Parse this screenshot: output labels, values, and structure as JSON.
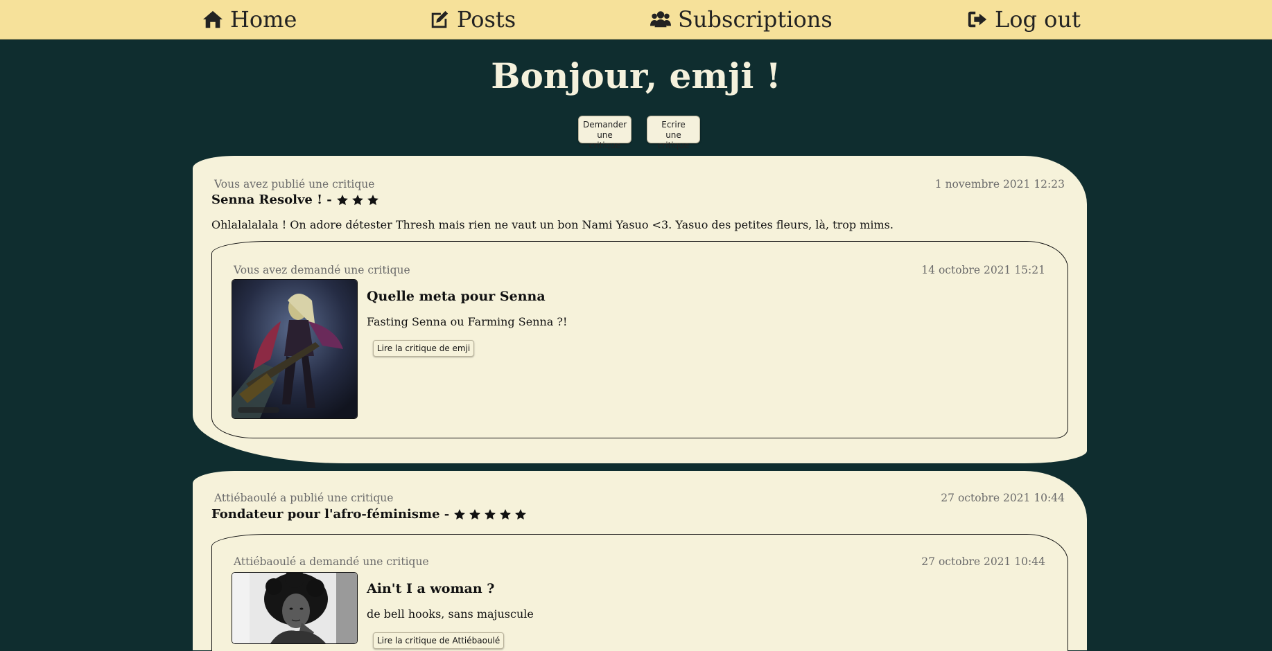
{
  "nav": {
    "home": {
      "label": "Home",
      "icon": "home-icon"
    },
    "posts": {
      "label": "Posts",
      "icon": "edit-icon"
    },
    "subscriptions": {
      "label": "Subscriptions",
      "icon": "users-icon"
    },
    "logout": {
      "label": "Log out",
      "icon": "sign-out-icon"
    }
  },
  "greeting": "Bonjour, emji !",
  "actions": {
    "request_line1": "Demander",
    "request_line2": "une critique",
    "write_line1": "Ecrire",
    "write_line2": "une critique"
  },
  "feed": [
    {
      "meta": "Vous avez publié une critique",
      "date": "1 novembre 2021 12:23",
      "headline": "Senna Resolve ! -",
      "rating": 3,
      "body": "Ohlalalalala ! On adore détester Thresh mais rien ne vaut un bon Nami Yasuo <3. Yasuo des petites fleurs, là, trop mims.",
      "ticket": {
        "meta": "Vous avez demandé une critique",
        "date": "14 octobre 2021 15:21",
        "title": "Quelle meta pour Senna",
        "description": "Fasting Senna ou Farming Senna ?!",
        "read_label": "Lire la critique de emji"
      }
    },
    {
      "meta": "Attiébaoulé a publié une critique",
      "date": "27 octobre 2021 10:44",
      "headline": "Fondateur pour l'afro-féminisme -",
      "rating": 5,
      "ticket": {
        "meta": "Attiébaoulé a demandé une critique",
        "date": "27 octobre 2021 10:44",
        "title": "Ain't I a woman ?",
        "description": "de bell hooks, sans majuscule",
        "read_label": "Lire la critique de Attiébaoulé"
      }
    }
  ],
  "colors": {
    "nav_bg": "#f6e19a",
    "page_bg": "#0f2d2f",
    "card_bg": "#f6f2da"
  }
}
